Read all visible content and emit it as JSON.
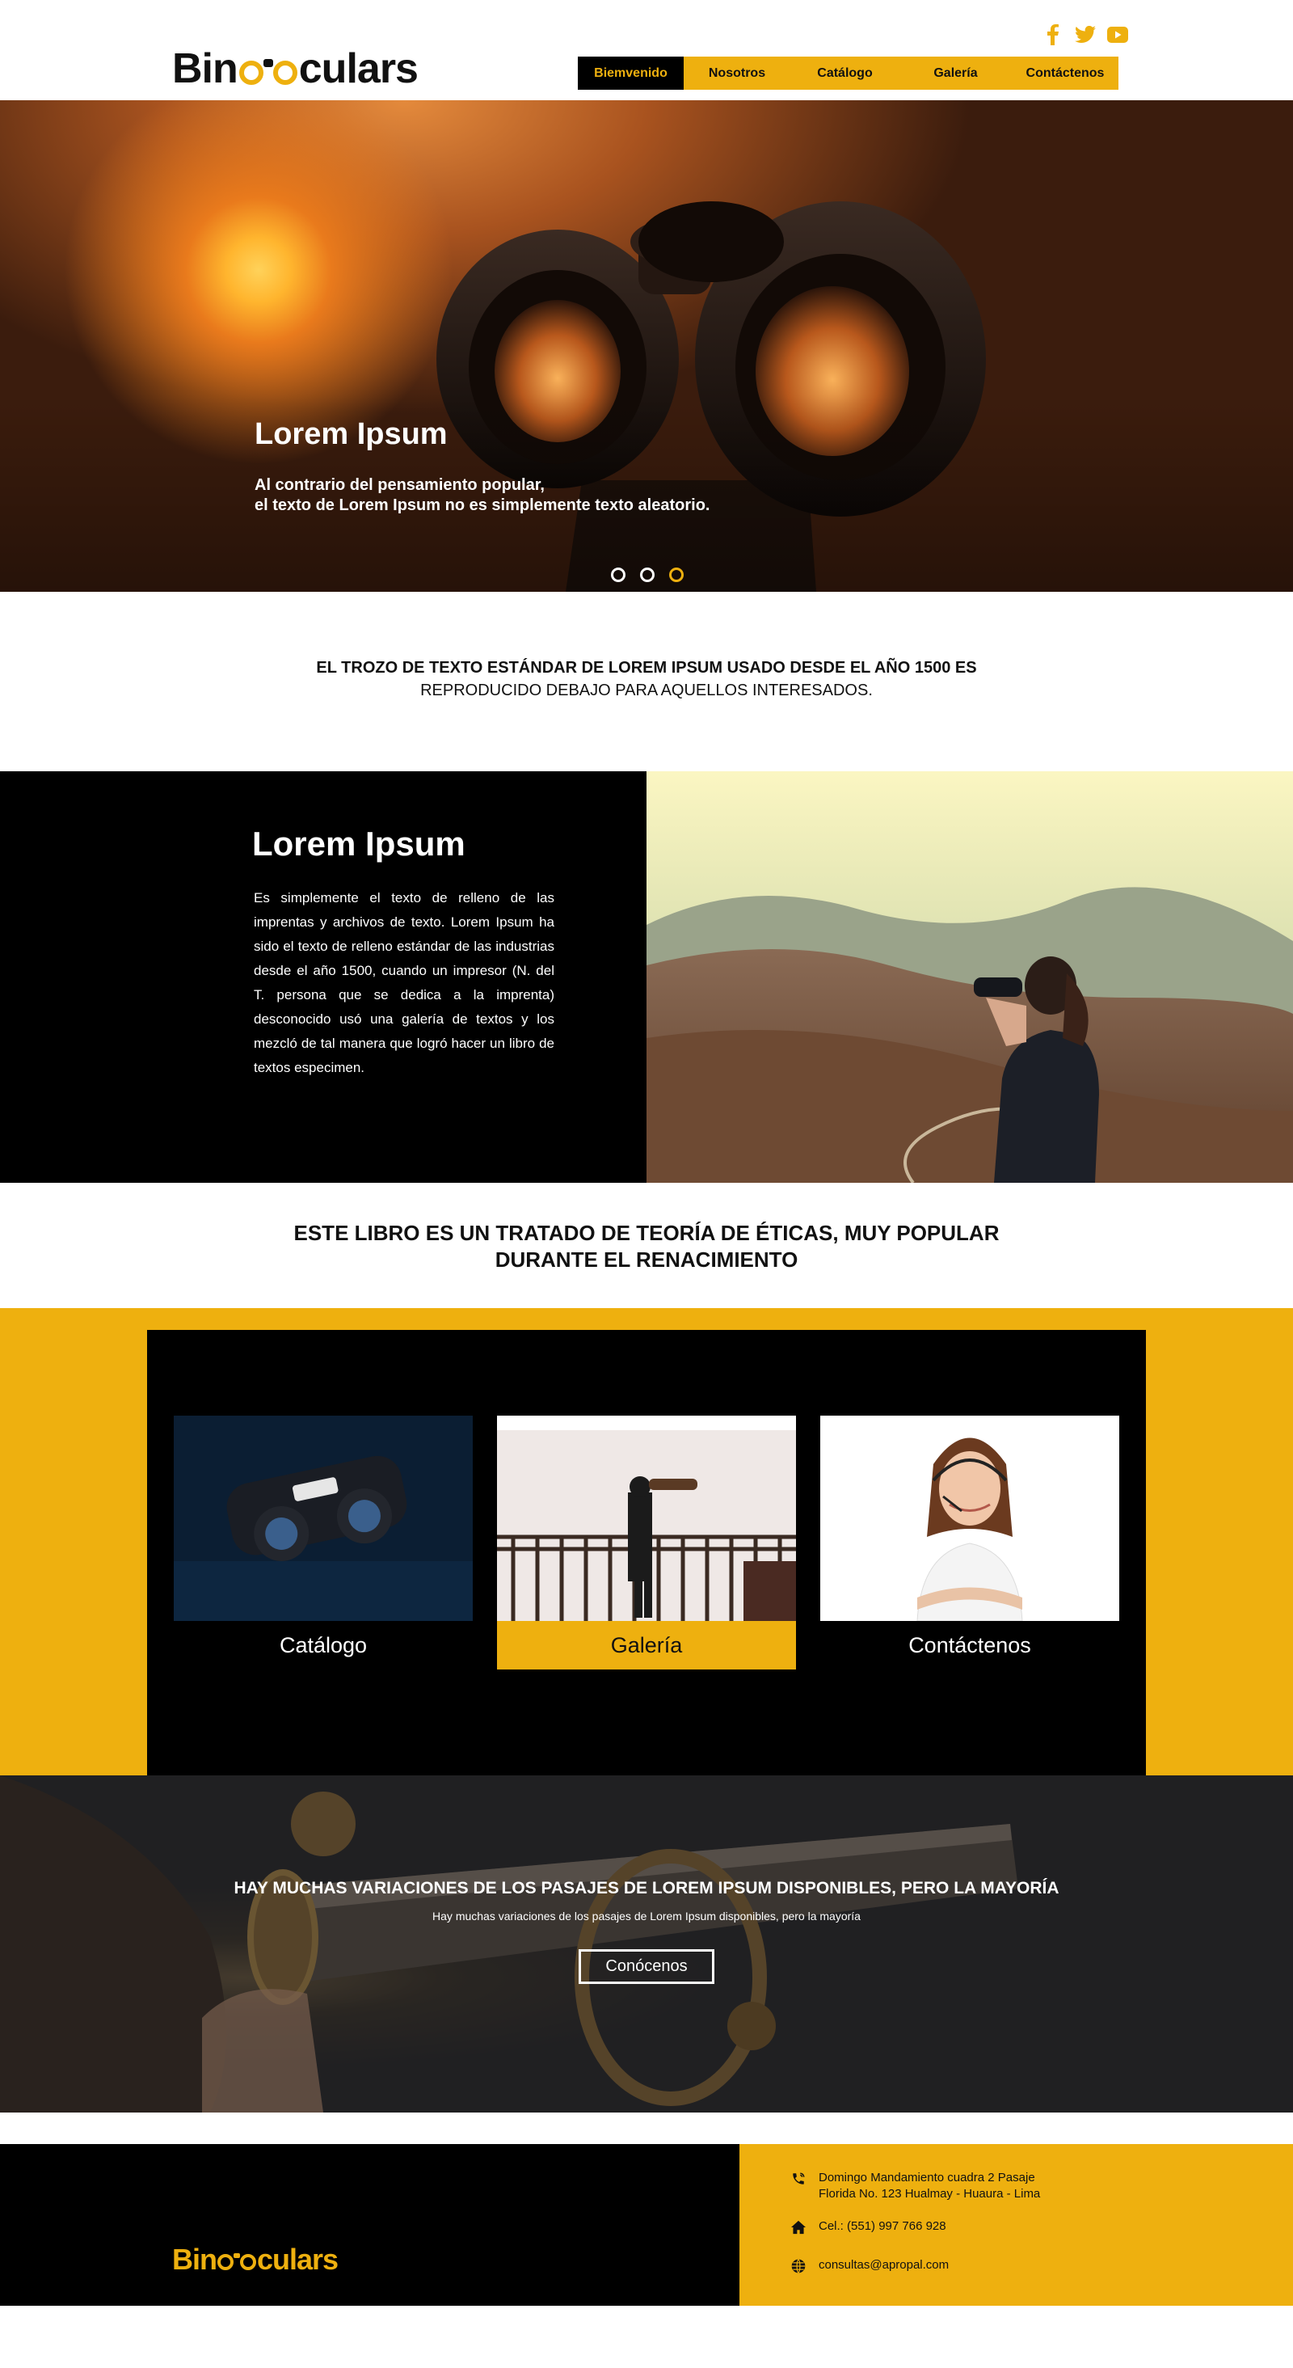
{
  "header": {
    "logo_text": "Binoculars",
    "logo_prefix": "Bin",
    "logo_suffix": "culars",
    "social": [
      "facebook-icon",
      "twitter-icon",
      "youtube-icon"
    ],
    "nav": [
      {
        "label": "Biemvenido",
        "active": true
      },
      {
        "label": "Nosotros",
        "active": false
      },
      {
        "label": "Catálogo",
        "active": false
      },
      {
        "label": "Galería",
        "active": false
      },
      {
        "label": "Contáctenos",
        "active": false
      }
    ]
  },
  "hero": {
    "title": "Lorem Ipsum",
    "line1": "Al contrario del pensamiento popular,",
    "line2": "el texto de Lorem Ipsum no es simplemente texto aleatorio.",
    "slides": 3,
    "active_slide": 3
  },
  "intro": {
    "line1": "EL TROZO DE TEXTO ESTÁNDAR DE LOREM IPSUM USADO DESDE EL AÑO 1500 ES",
    "line2": "REPRODUCIDO DEBAJO PARA AQUELLOS INTERESADOS."
  },
  "feature": {
    "title": "Lorem Ipsum",
    "body": "Es simplemente el texto de relleno de las imprentas y archivos de texto. Lorem Ipsum ha sido el texto de relleno estándar de las industrias desde el año 1500, cuando un impresor (N. del T. persona que se dedica a la imprenta) desconocido usó una galería de textos y los mezcló de tal manera que logró hacer un libro de textos especimen."
  },
  "band": {
    "line1": "ESTE LIBRO ES UN TRATADO DE TEORÍA DE ÉTICAS, MUY POPULAR",
    "line2": "DURANTE EL RENACIMIENTO"
  },
  "cards": [
    {
      "label": "Catálogo"
    },
    {
      "label": "Galería"
    },
    {
      "label": "Contáctenos"
    }
  ],
  "promo": {
    "title": "HAY MUCHAS VARIACIONES DE LOS PASAJES DE LOREM IPSUM DISPONIBLES, PERO LA MAYORÍA",
    "subtitle": "Hay muchas variaciones de los pasajes de Lorem Ipsum disponibles, pero la mayoría",
    "button": "Conócenos"
  },
  "footer": {
    "logo_text": "Binoculars",
    "logo_prefix": "Bin",
    "logo_suffix": "culars",
    "address_line1": "Domingo Mandamiento  cuadra 2   Pasaje",
    "address_line2": "Florida No. 123  Hualmay - Huaura - Lima",
    "phone": "Cel.: (551) 997 766 928",
    "email": "consultas@apropal.com"
  },
  "colors": {
    "accent": "#eeb00f",
    "dark": "#000000",
    "light": "#ffffff"
  }
}
